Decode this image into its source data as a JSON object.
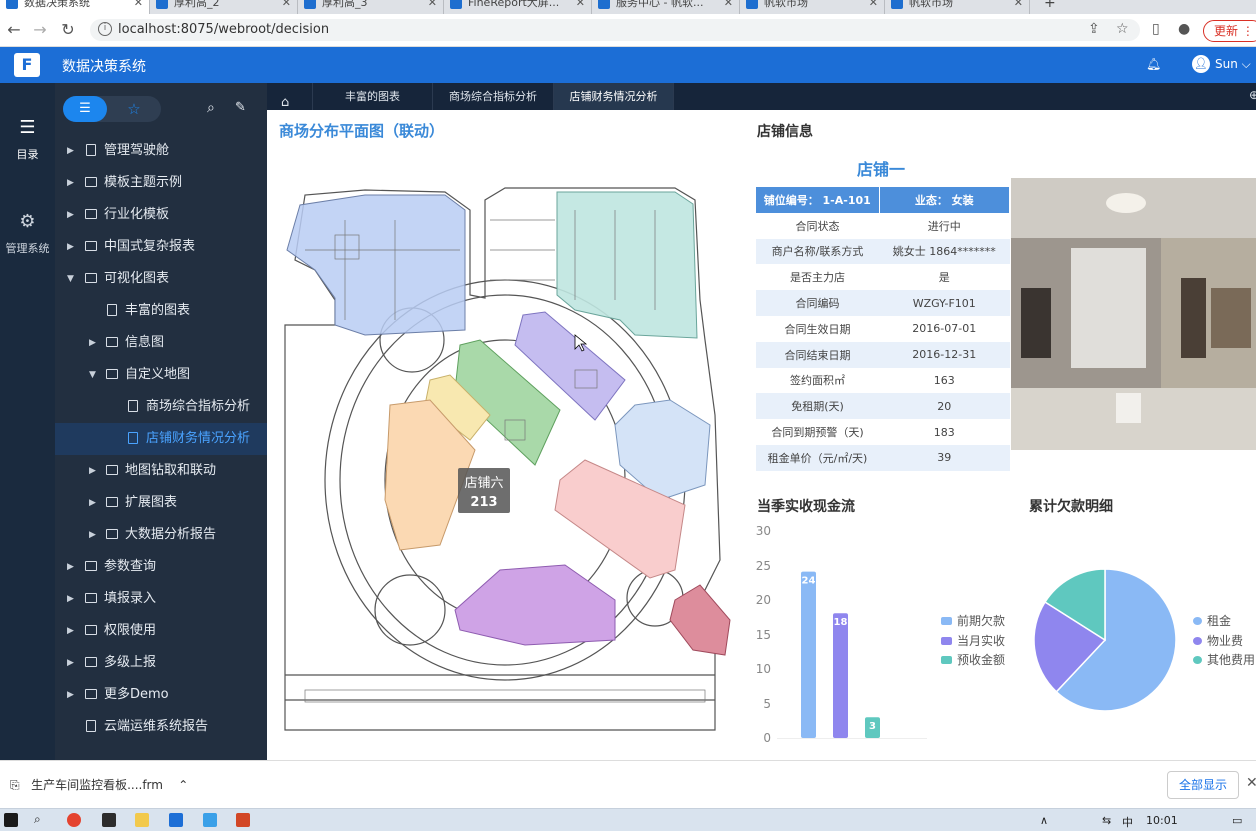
{
  "browser": {
    "tabs": [
      {
        "title": "数据决策系统"
      },
      {
        "title": "厚利高_2"
      },
      {
        "title": "厚利高_3"
      },
      {
        "title": "FineReport大屏..."
      },
      {
        "title": "服务中心 - 帆软..."
      },
      {
        "title": "帆软市场"
      },
      {
        "title": "帆软市场"
      }
    ],
    "url": "localhost:8075/webroot/decision",
    "update_label": "更新"
  },
  "app": {
    "title": "数据决策系统",
    "user": "Sun"
  },
  "rail": {
    "items": [
      {
        "label": "目录",
        "icon": "list-icon"
      },
      {
        "label": "管理系统",
        "icon": "gear-icon"
      }
    ]
  },
  "sidebar": {
    "items": [
      {
        "label": "管理驾驶舱"
      },
      {
        "label": "模板主题示例"
      },
      {
        "label": "行业化模板"
      },
      {
        "label": "中国式复杂报表"
      },
      {
        "label": "可视化图表"
      },
      {
        "label": "丰富的图表"
      },
      {
        "label": "信息图"
      },
      {
        "label": "自定义地图"
      },
      {
        "label": "商场综合指标分析"
      },
      {
        "label": "店铺财务情况分析"
      },
      {
        "label": "地图钻取和联动"
      },
      {
        "label": "扩展图表"
      },
      {
        "label": "大数据分析报告"
      },
      {
        "label": "参数查询"
      },
      {
        "label": "填报录入"
      },
      {
        "label": "权限使用"
      },
      {
        "label": "多级上报"
      },
      {
        "label": "更多Demo"
      },
      {
        "label": "云端运维系统报告"
      }
    ]
  },
  "content_tabs": [
    {
      "label": "丰富的图表"
    },
    {
      "label": "商场综合指标分析"
    },
    {
      "label": "店铺财务情况分析"
    }
  ],
  "map": {
    "title": "商场分布平面图（联动）",
    "tooltip_name": "店铺六",
    "tooltip_value": "213"
  },
  "shop_info": {
    "title": "店铺信息",
    "shop_name": "店铺一",
    "header_left": "铺位编号： 1-A-101",
    "header_right": "业态： 女装",
    "rows": [
      {
        "label": "合同状态",
        "value": "进行中"
      },
      {
        "label": "商户名称/联系方式",
        "value": "姚女士 1864*******"
      },
      {
        "label": "是否主力店",
        "value": "是"
      },
      {
        "label": "合同编码",
        "value": "WZGY-F101"
      },
      {
        "label": "合同生效日期",
        "value": "2016-07-01"
      },
      {
        "label": "合同结束日期",
        "value": "2016-12-31"
      },
      {
        "label": "签约面积㎡",
        "value": "163"
      },
      {
        "label": "免租期(天)",
        "value": "20"
      },
      {
        "label": "合同到期预警（天)",
        "value": "183"
      },
      {
        "label": "租金单价（元/㎡/天)",
        "value": "39"
      }
    ]
  },
  "chart_data": [
    {
      "type": "bar",
      "title": "当季实收现金流",
      "categories": [
        "前期欠款",
        "当月实收",
        "预收金额"
      ],
      "values": [
        24,
        18,
        3
      ],
      "ylim": [
        0,
        30
      ],
      "yticks": [
        "0",
        "5",
        "10",
        "15",
        "20",
        "25",
        "30"
      ],
      "colors": [
        "#8ab9f5",
        "#8f86ee",
        "#5fc8bf"
      ],
      "legend_position": "right"
    },
    {
      "type": "pie",
      "title": "累计欠款明细",
      "categories": [
        "租金",
        "物业费",
        "其他费用"
      ],
      "values": [
        62,
        22,
        16
      ],
      "colors": [
        "#8ab9f5",
        "#8f86ee",
        "#5fc8bf"
      ],
      "legend_position": "right"
    }
  ],
  "downloads": {
    "file": "生产车间监控看板....frm",
    "show_all": "全部显示"
  },
  "taskbar": {
    "ime": "中",
    "time": "10:01"
  }
}
